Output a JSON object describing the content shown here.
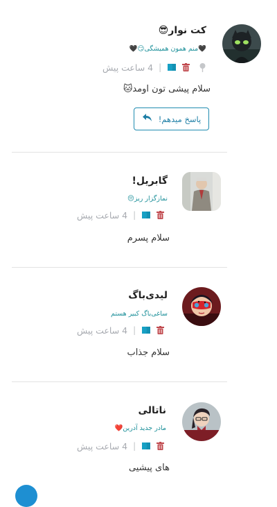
{
  "colors": {
    "accent": "#1b8f99",
    "flag": "#17a0c4",
    "trash": "#c0484d",
    "meta": "#a7aab0",
    "link_blue": "#1f7fa6"
  },
  "comments": [
    {
      "username": "کت نوار😎",
      "status": "🖤منم همون همیشگی😏🖤",
      "time": "4 ساعت پیش",
      "separator": "|",
      "text": "سلام پیشی تون اومد🐱",
      "has_pin": true,
      "reply_button": "پاسخ میدهم!"
    },
    {
      "username": "گابریل!",
      "status": "نمازگزار ریز😔",
      "time": "4 ساعت پیش",
      "separator": "|",
      "text": "سلام پسرم"
    },
    {
      "username": "لیدی‌باگ",
      "status": "ساغی‌باگ کبیر هستم",
      "time": "4 ساعت پیش",
      "separator": "|",
      "text": "سلام جذاب"
    },
    {
      "username": "ناتالی",
      "status": "مادر جدید آدرین❤️",
      "time": "4 ساعت پیش",
      "separator": "|",
      "text": "های پیشیی"
    }
  ],
  "icons": {
    "flag": "flag-icon",
    "trash": "trash-icon",
    "pin": "pin-icon",
    "reply": "reply-arrow-icon"
  }
}
